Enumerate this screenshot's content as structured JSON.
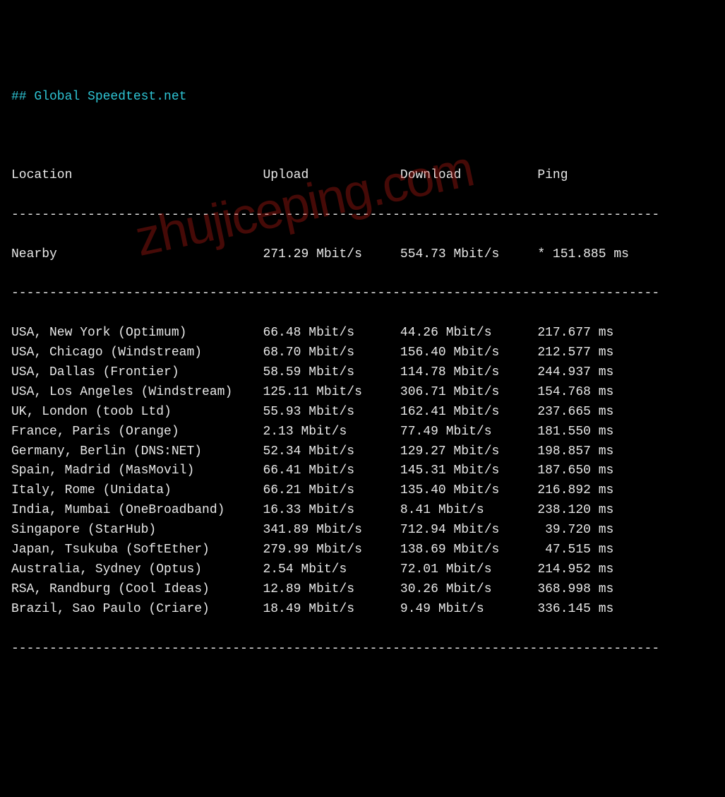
{
  "title": "## Global Speedtest.net",
  "headers": {
    "location": "Location",
    "upload": "Upload",
    "download": "Download",
    "ping": "Ping"
  },
  "separator": "-------------------------------------------------------------------------------------",
  "nearby": {
    "location": "Nearby",
    "upload": "271.29 Mbit/s",
    "download": "554.73 Mbit/s",
    "ping": "* 151.885 ms"
  },
  "rows": [
    {
      "location": "USA, New York (Optimum)",
      "upload": "66.48 Mbit/s",
      "download": "44.26 Mbit/s",
      "ping": "217.677 ms"
    },
    {
      "location": "USA, Chicago (Windstream)",
      "upload": "68.70 Mbit/s",
      "download": "156.40 Mbit/s",
      "ping": "212.577 ms"
    },
    {
      "location": "USA, Dallas (Frontier)",
      "upload": "58.59 Mbit/s",
      "download": "114.78 Mbit/s",
      "ping": "244.937 ms"
    },
    {
      "location": "USA, Los Angeles (Windstream)",
      "upload": "125.11 Mbit/s",
      "download": "306.71 Mbit/s",
      "ping": "154.768 ms"
    },
    {
      "location": "UK, London (toob Ltd)",
      "upload": "55.93 Mbit/s",
      "download": "162.41 Mbit/s",
      "ping": "237.665 ms"
    },
    {
      "location": "France, Paris (Orange)",
      "upload": "2.13 Mbit/s",
      "download": "77.49 Mbit/s",
      "ping": "181.550 ms"
    },
    {
      "location": "Germany, Berlin (DNS:NET)",
      "upload": "52.34 Mbit/s",
      "download": "129.27 Mbit/s",
      "ping": "198.857 ms"
    },
    {
      "location": "Spain, Madrid (MasMovil)",
      "upload": "66.41 Mbit/s",
      "download": "145.31 Mbit/s",
      "ping": "187.650 ms"
    },
    {
      "location": "Italy, Rome (Unidata)",
      "upload": "66.21 Mbit/s",
      "download": "135.40 Mbit/s",
      "ping": "216.892 ms"
    },
    {
      "location": "India, Mumbai (OneBroadband)",
      "upload": "16.33 Mbit/s",
      "download": "8.41 Mbit/s",
      "ping": "238.120 ms"
    },
    {
      "location": "Singapore (StarHub)",
      "upload": "341.89 Mbit/s",
      "download": "712.94 Mbit/s",
      "ping": " 39.720 ms"
    },
    {
      "location": "Japan, Tsukuba (SoftEther)",
      "upload": "279.99 Mbit/s",
      "download": "138.69 Mbit/s",
      "ping": " 47.515 ms"
    },
    {
      "location": "Australia, Sydney (Optus)",
      "upload": "2.54 Mbit/s",
      "download": "72.01 Mbit/s",
      "ping": "214.952 ms"
    },
    {
      "location": "RSA, Randburg (Cool Ideas)",
      "upload": "12.89 Mbit/s",
      "download": "30.26 Mbit/s",
      "ping": "368.998 ms"
    },
    {
      "location": "Brazil, Sao Paulo (Criare)",
      "upload": "18.49 Mbit/s",
      "download": "9.49 Mbit/s",
      "ping": "336.145 ms"
    }
  ],
  "watermark": "zhujiceping.com",
  "columns": {
    "location_width": 33,
    "upload_width": 18,
    "download_width": 18
  }
}
